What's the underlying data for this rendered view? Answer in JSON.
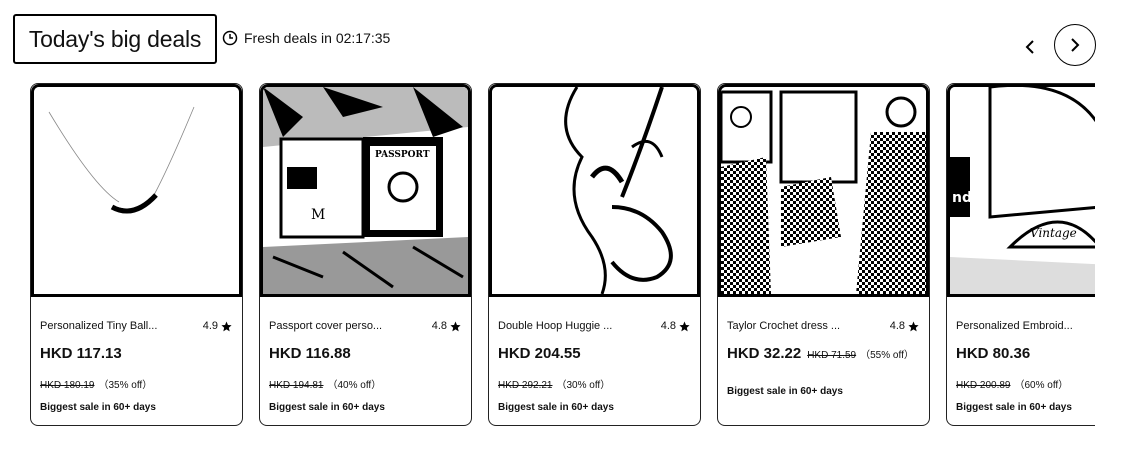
{
  "header": {
    "title": "Today's big deals",
    "fresh_label": "Fresh deals in 02:17:35"
  },
  "products": [
    {
      "name": "Personalized Tiny Ball...",
      "rating": "4.9",
      "price": "HKD 117.13",
      "original_price": "HKD 180.19",
      "discount": "（35% off）",
      "badge": "Biggest sale in 60+ days"
    },
    {
      "name": "Passport cover perso...",
      "rating": "4.8",
      "price": "HKD 116.88",
      "original_price": "HKD 194.81",
      "discount": "（40% off）",
      "badge": "Biggest sale in 60+ days"
    },
    {
      "name": "Double Hoop Huggie ...",
      "rating": "4.8",
      "price": "HKD 204.55",
      "original_price": "HKD 292.21",
      "discount": "（30% off）",
      "badge": "Biggest sale in 60+ days"
    },
    {
      "name": "Taylor Crochet dress ...",
      "rating": "4.8",
      "price": "HKD 32.22",
      "original_price": "HKD 71.59",
      "discount": "（55% off）",
      "badge": "Biggest sale in 60+ days"
    },
    {
      "name": "Personalized Embroid...",
      "rating": "",
      "price": "HKD 80.36",
      "original_price": "HKD 200.89",
      "discount": "（60% off）",
      "badge": "Biggest sale in 60+ days"
    }
  ],
  "icons": {
    "clock": "clock-icon",
    "prev": "chevron-left-icon",
    "next": "chevron-right-icon",
    "star": "star-icon"
  }
}
